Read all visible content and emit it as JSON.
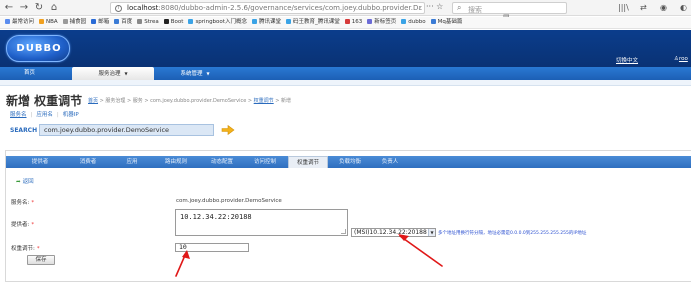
{
  "browser": {
    "url_host": "localhost",
    "url_rest": ":8080/dubbo-admin-2.5.6/governance/services/com.joey.dubbo.provider.Dε",
    "search_placeholder": "搜索",
    "bookmarks": [
      {
        "label": "最常访问",
        "color": "#5b8def"
      },
      {
        "label": "NBA",
        "color": "#f0a020"
      },
      {
        "label": "捕食园",
        "color": "#9a9a9a"
      },
      {
        "label": "邮箱",
        "color": "#2a6bd6"
      },
      {
        "label": "百度",
        "color": "#3a7bd5"
      },
      {
        "label": "Strea",
        "color": "#888888"
      },
      {
        "label": "Boot",
        "color": "#222222"
      },
      {
        "label": "springboot入门概念",
        "color": "#3aa3e6"
      },
      {
        "label": "腾讯课堂",
        "color": "#3aa3e6"
      },
      {
        "label": "码王教育_腾讯课堂",
        "color": "#3aa3e6"
      },
      {
        "label": "163",
        "color": "#d63a3a"
      },
      {
        "label": "新标签页",
        "color": "#6b6bd6"
      },
      {
        "label": "dubbo",
        "color": "#3aa3e6"
      },
      {
        "label": "Mq基础篇",
        "color": "#3a7bd5"
      }
    ]
  },
  "app": {
    "logo": "DUBBO",
    "lang_link": "切换中文",
    "user": "roo"
  },
  "menu": {
    "items": [
      "首页",
      "服务治理",
      "系统管理"
    ],
    "active_index": 1
  },
  "page": {
    "title": "新增 权重调节",
    "breadcrumb": [
      {
        "text": "首页",
        "link": true
      },
      {
        "text": " > 服务治理 > 服务 > com.joey.dubbo.provider.DemoService > ",
        "link": false
      },
      {
        "text": "权重调节",
        "link": true
      },
      {
        "text": " > 新增",
        "link": false
      }
    ],
    "sub_tabs": [
      "服务名",
      "应用名",
      "机器IP"
    ],
    "sub_tab_selected": 0,
    "search_label": "SEARCH",
    "search_value": "com.joey.dubbo.provider.DemoService"
  },
  "tabs": {
    "items": [
      "提供者",
      "消费者",
      "应用",
      "路由规则",
      "动态配置",
      "访问控制",
      "权重调节",
      "负载均衡",
      "负责人"
    ],
    "active_index": 6
  },
  "form": {
    "back_label": "返回",
    "service_label": "服务名:",
    "service_value": "com.joey.dubbo.provider.DemoService",
    "provider_label": "提供者:",
    "provider_value": "10.12.34.22:20188",
    "provider_select": "(MSI)10.12.34.22:20188",
    "provider_hint": "多个地址用换行符分隔，地址必需是0.0.0.0到255.255.255.255的IP地址",
    "weight_label": "权重调节:",
    "weight_value": "10",
    "save_label": "保存"
  }
}
